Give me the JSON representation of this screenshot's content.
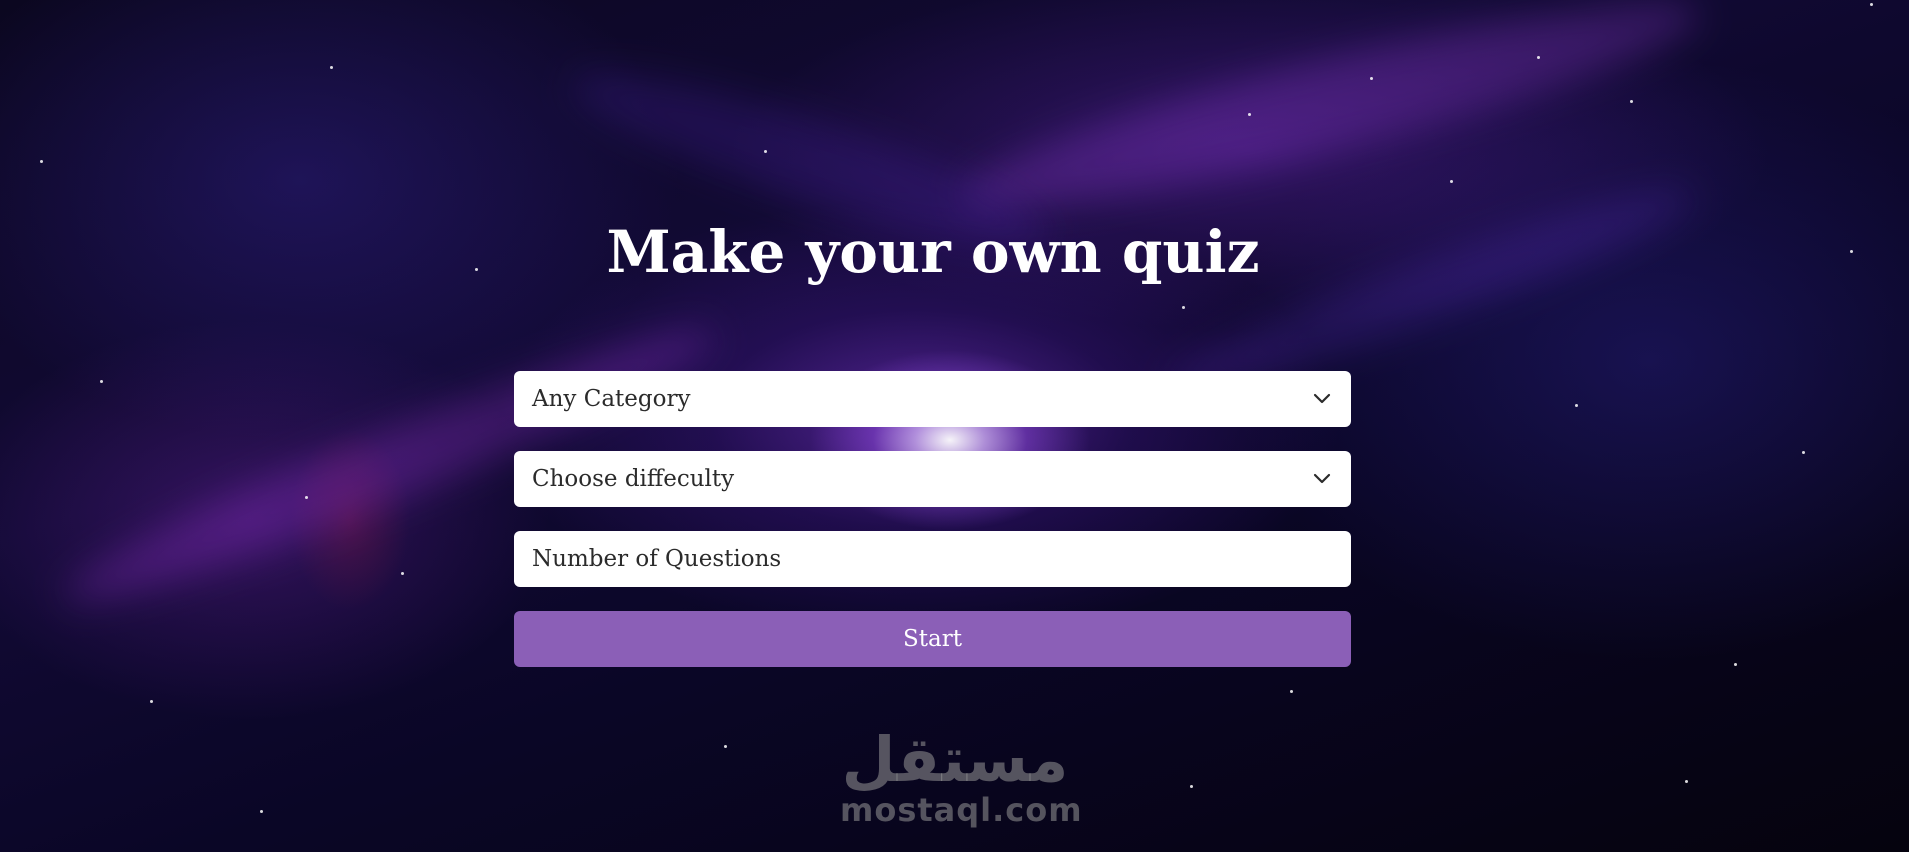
{
  "page": {
    "title": "Make your own quiz"
  },
  "form": {
    "category": {
      "selected": "Any Category",
      "icon": "chevron-down-icon"
    },
    "difficulty": {
      "selected": "Choose diffeculty",
      "icon": "chevron-down-icon"
    },
    "questions": {
      "placeholder": "Number of Questions",
      "value": ""
    },
    "start_label": "Start"
  },
  "watermark": {
    "arabic": "مستقل",
    "latin": "mostaql.com"
  },
  "colors": {
    "button": "#8b5fb7",
    "title": "#ffffff",
    "field_bg": "#ffffff",
    "field_text": "#2b2b2b"
  }
}
